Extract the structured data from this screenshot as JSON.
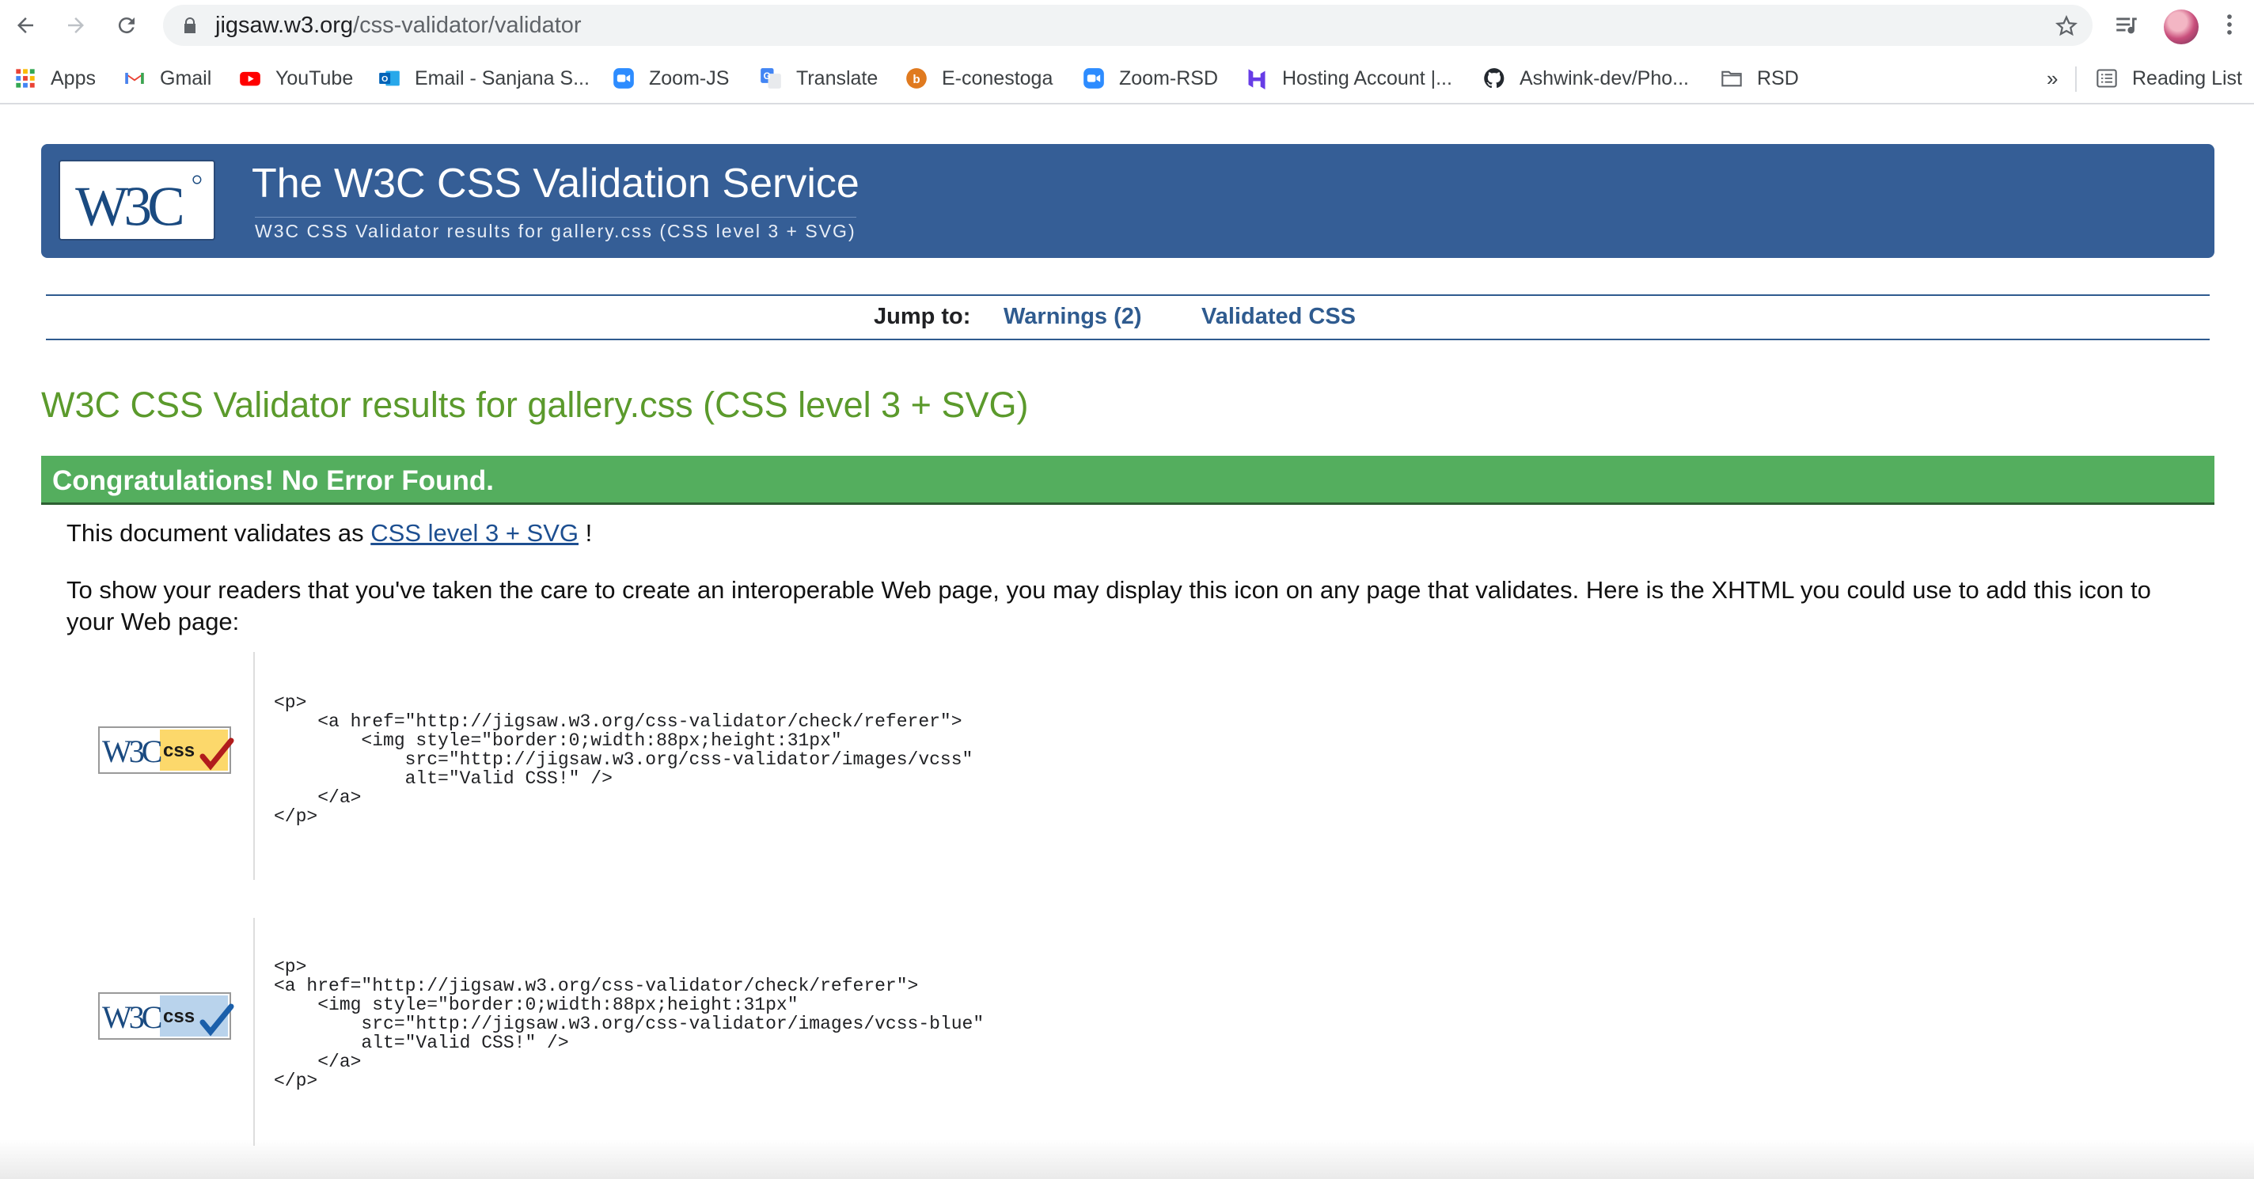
{
  "browser": {
    "url_host": "jigsaw.w3.org",
    "url_path": "/css-validator/validator",
    "bookmarks": [
      {
        "label": "Apps",
        "icon": "apps-grid-icon"
      },
      {
        "label": "Gmail",
        "icon": "gmail-icon"
      },
      {
        "label": "YouTube",
        "icon": "youtube-icon"
      },
      {
        "label": "Email - Sanjana S...",
        "icon": "outlook-icon"
      },
      {
        "label": "Zoom-JS",
        "icon": "zoom-icon"
      },
      {
        "label": "Translate",
        "icon": "translate-icon"
      },
      {
        "label": "E-conestoga",
        "icon": "conestoga-icon"
      },
      {
        "label": "Zoom-RSD",
        "icon": "zoom-icon"
      },
      {
        "label": "Hosting Account |...",
        "icon": "hostinger-icon"
      },
      {
        "label": "Ashwink-dev/Pho...",
        "icon": "github-icon"
      },
      {
        "label": "RSD",
        "icon": "folder-icon"
      }
    ],
    "overflow_label": "»",
    "reading_list_label": "Reading List"
  },
  "banner": {
    "logo_text": "W3C",
    "title": "The W3C CSS Validation Service",
    "subtitle": "W3C CSS Validator results for gallery.css (CSS level 3 + SVG)"
  },
  "jump": {
    "label": "Jump to:",
    "warnings_link": "Warnings (2)",
    "validated_link": "Validated CSS"
  },
  "results": {
    "title": "W3C CSS Validator results for gallery.css (CSS level 3 + SVG)",
    "congrats": "Congratulations! No Error Found.",
    "validates_prefix": "This document validates as ",
    "validates_link": "CSS level 3 + SVG",
    "validates_suffix": " !",
    "icon_paragraph": "To show your readers that you've taken the care to create an interoperable Web page, you may display this icon on any page that validates. Here is the XHTML you could use to add this icon to your Web page:"
  },
  "badges": [
    {
      "alt": "Valid CSS!",
      "badge_text_w3c": "W3C",
      "badge_text_css": "css",
      "variant": "gold",
      "code": "<p>\n    <a href=\"http://jigsaw.w3.org/css-validator/check/referer\">\n        <img style=\"border:0;width:88px;height:31px\"\n            src=\"http://jigsaw.w3.org/css-validator/images/vcss\"\n            alt=\"Valid CSS!\" />\n    </a>\n</p>"
    },
    {
      "alt": "Valid CSS!",
      "badge_text_w3c": "W3C",
      "badge_text_css": "css",
      "variant": "blue",
      "code": "<p>\n<a href=\"http://jigsaw.w3.org/css-validator/check/referer\">\n    <img style=\"border:0;width:88px;height:31px\"\n        src=\"http://jigsaw.w3.org/css-validator/images/vcss-blue\"\n        alt=\"Valid CSS!\" />\n    </a>\n</p>"
    }
  ],
  "colors": {
    "banner_blue": "#355e96",
    "success_green": "#54ae5e",
    "title_green": "#5b9a2c",
    "link_blue": "#2f5b8f"
  }
}
